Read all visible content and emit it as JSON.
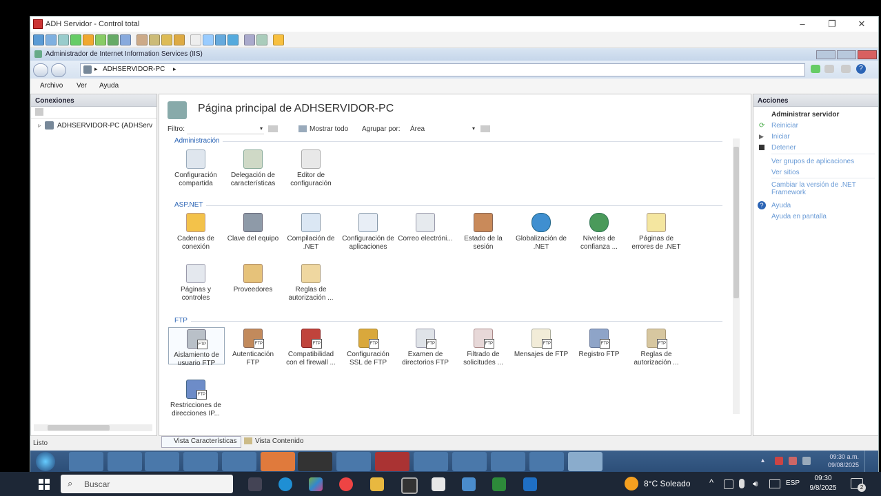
{
  "remote_window": {
    "title": "ADH Servidor - Control total",
    "controls": [
      "–",
      "❐",
      "✕"
    ]
  },
  "iis": {
    "title": "Administrador de Internet Information Services (IIS)",
    "breadcrumb": [
      "ADHSERVIDOR-PC",
      "▸"
    ],
    "menu": [
      "Archivo",
      "Ver",
      "Ayuda"
    ],
    "connections": {
      "header": "Conexiones",
      "tree_item": "ADHSERVIDOR-PC (ADHServ"
    },
    "main": {
      "title": "Página principal de ADHSERVIDOR-PC",
      "filter_label": "Filtro:",
      "show_all": "Mostrar todo",
      "group_by_label": "Agrupar por:",
      "group_by_value": "Área",
      "groups": [
        {
          "name": "Administración",
          "items": [
            {
              "label": "Configuración compartida",
              "icon": "shared-config-icon"
            },
            {
              "label": "Delegación de características",
              "icon": "delegation-icon"
            },
            {
              "label": "Editor de configuración",
              "icon": "config-editor-icon"
            }
          ]
        },
        {
          "name": "ASP.NET",
          "items": [
            {
              "label": "Cadenas de conexión",
              "icon": "connection-strings-icon"
            },
            {
              "label": "Clave del equipo",
              "icon": "machine-key-icon"
            },
            {
              "label": "Compilación de .NET",
              "icon": "compilation-icon"
            },
            {
              "label": "Configuración de aplicaciones",
              "icon": "app-settings-icon"
            },
            {
              "label": "Correo electróni...",
              "icon": "email-icon"
            },
            {
              "label": "Estado de la sesión",
              "icon": "session-state-icon"
            },
            {
              "label": "Globalización de .NET",
              "icon": "globe-icon"
            },
            {
              "label": "Niveles de confianza ...",
              "icon": "trust-levels-icon"
            },
            {
              "label": "Páginas de errores de .NET",
              "icon": "error-pages-icon"
            },
            {
              "label": "Páginas y controles",
              "icon": "pages-controls-icon"
            },
            {
              "label": "Proveedores",
              "icon": "providers-icon"
            },
            {
              "label": "Reglas de autorización ...",
              "icon": "authorization-icon"
            }
          ]
        },
        {
          "name": "FTP",
          "items": [
            {
              "label": "Aislamiento de usuario FTP",
              "icon": "ftp-user-isolation-icon"
            },
            {
              "label": "Autenticación FTP",
              "icon": "ftp-auth-icon"
            },
            {
              "label": "Compatibilidad con el firewall ...",
              "icon": "ftp-firewall-icon"
            },
            {
              "label": "Configuración SSL de FTP",
              "icon": "ftp-ssl-icon"
            },
            {
              "label": "Examen de directorios FTP",
              "icon": "ftp-directory-icon"
            },
            {
              "label": "Filtrado de solicitudes ...",
              "icon": "ftp-filter-icon"
            },
            {
              "label": "Mensajes de FTP",
              "icon": "ftp-messages-icon"
            },
            {
              "label": "Registro FTP",
              "icon": "ftp-log-icon"
            },
            {
              "label": "Reglas de autorización ...",
              "icon": "ftp-authorization-icon"
            },
            {
              "label": "Restricciones de direcciones IP...",
              "icon": "ftp-ip-restrictions-icon"
            }
          ]
        }
      ],
      "view_tabs": [
        "Vista Características",
        "Vista Contenido"
      ]
    },
    "actions": {
      "header": "Acciones",
      "manage_server": "Administrar servidor",
      "restart": "Reiniciar",
      "start": "Iniciar",
      "stop": "Detener",
      "view_app_pools": "Ver grupos de aplicaciones",
      "view_sites": "Ver sitios",
      "change_net": "Cambiar la versión de .NET Framework",
      "help": "Ayuda",
      "online_help": "Ayuda en pantalla"
    },
    "status": "Listo"
  },
  "remote_taskbar": {
    "time": "09:30 a.m.",
    "date": "09/08/2025"
  },
  "host_taskbar": {
    "search_placeholder": "Buscar",
    "weather": "8°C Soleado",
    "language": "ESP",
    "time": "09:30",
    "date": "9/8/2025",
    "notifications": "2"
  },
  "colors": {
    "accent": "#2b64b5",
    "link": "#6a9bd6",
    "remote_taskbar": "#2c4e78",
    "host_taskbar": "#1d2736"
  }
}
